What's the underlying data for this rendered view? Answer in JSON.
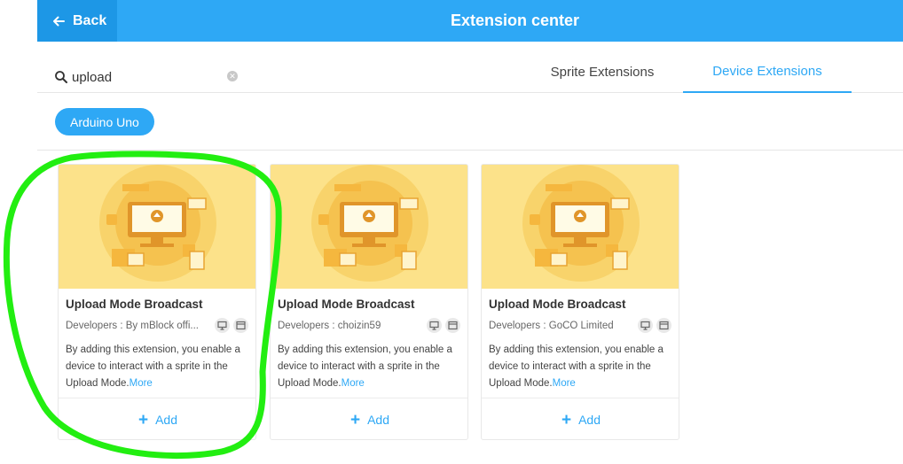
{
  "header": {
    "back_label": "Back",
    "title": "Extension center"
  },
  "search": {
    "value": "upload",
    "placeholder": ""
  },
  "tabs": [
    {
      "label": "Sprite Extensions",
      "active": false
    },
    {
      "label": "Device Extensions",
      "active": true
    }
  ],
  "filters": {
    "device_chip": "Arduino Uno"
  },
  "cards": [
    {
      "title": "Upload Mode Broadcast",
      "developer": "Developers : By mBlock offi...",
      "description": "By adding this extension, you enable a device to interact with a sprite in the Upload Mode.",
      "more": "More",
      "add": "Add"
    },
    {
      "title": "Upload Mode Broadcast",
      "developer": "Developers : choizin59",
      "description": "By adding this extension, you enable a device to interact with a sprite in the Upload Mode.",
      "more": "More",
      "add": "Add"
    },
    {
      "title": "Upload Mode Broadcast",
      "developer": "Developers : GoCO Limited",
      "description": "By adding this extension, you enable a device to interact with a sprite in the Upload Mode.",
      "more": "More",
      "add": "Add"
    }
  ],
  "colors": {
    "accent": "#2ea8f5",
    "card_image_bg": "#fce28a",
    "annotation": "#22ee11"
  }
}
